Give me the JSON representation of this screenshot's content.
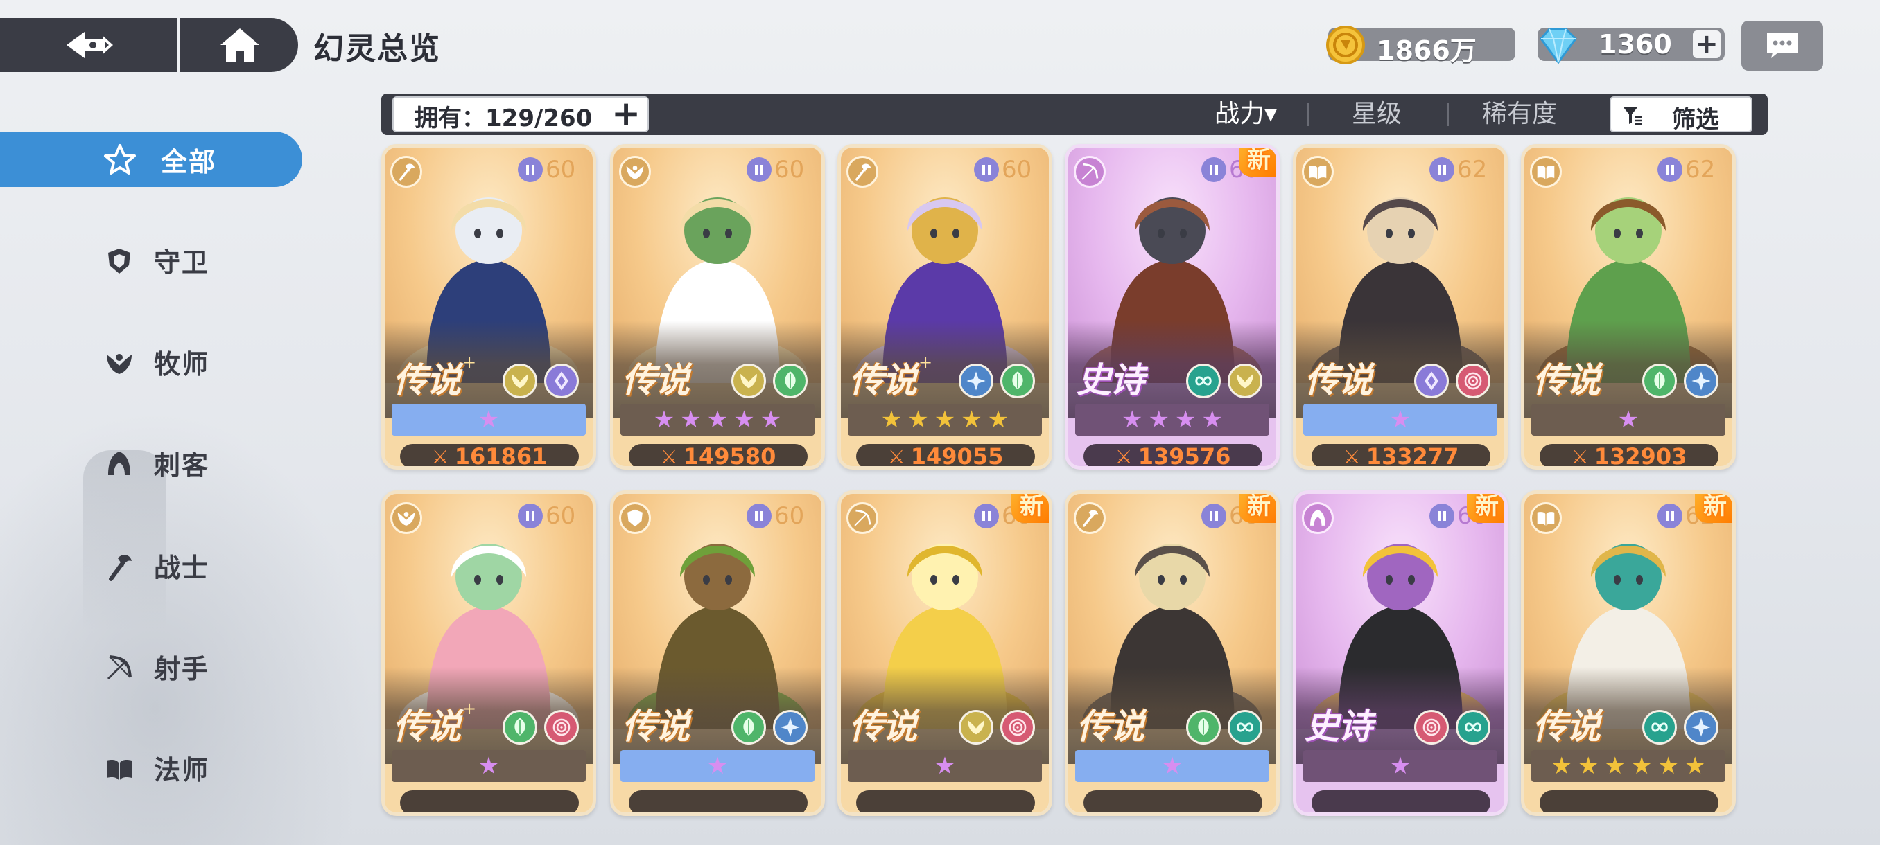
{
  "header": {
    "title": "幻灵总览",
    "gold": "1866万",
    "gems": "1360",
    "plus": "+"
  },
  "sidebar": {
    "items": [
      {
        "label": "全部",
        "icon": "all-star-icon",
        "active": true
      },
      {
        "label": "守卫",
        "icon": "shield-icon",
        "active": false
      },
      {
        "label": "牧师",
        "icon": "priest-wing-icon",
        "active": false
      },
      {
        "label": "刺客",
        "icon": "assassin-hood-icon",
        "active": false
      },
      {
        "label": "战士",
        "icon": "axe-icon",
        "active": false
      },
      {
        "label": "射手",
        "icon": "bow-icon",
        "active": false
      },
      {
        "label": "法师",
        "icon": "book-icon",
        "active": false
      }
    ]
  },
  "toolbar": {
    "owned": "拥有：129/260",
    "plus": "+",
    "sort_power": "战力▾",
    "sort_stars": "星级",
    "sort_rarity": "稀有度",
    "filter": "筛选"
  },
  "cards": [
    {
      "rarity": "传说",
      "plus": true,
      "level": "60",
      "class_icon": "axe-icon",
      "elements": [
        "wing-emblem-icon",
        "diamond-emblem-icon"
      ],
      "stars": 1,
      "star_color": "#d78ef0",
      "star_bar": "blue",
      "power": "161861",
      "new": false,
      "epic": false
    },
    {
      "rarity": "传说",
      "plus": false,
      "level": "60",
      "class_icon": "priest-wing-icon",
      "elements": [
        "wing-emblem-icon",
        "leaf-emblem-icon"
      ],
      "stars": 5,
      "star_color": "#d78ef0",
      "star_bar": "dark",
      "power": "149580",
      "new": false,
      "epic": false
    },
    {
      "rarity": "传说",
      "plus": true,
      "level": "60",
      "class_icon": "axe-icon",
      "elements": [
        "frost-emblem-icon",
        "leaf-emblem-icon"
      ],
      "stars": 5,
      "star_color": "#f2c23a",
      "star_bar": "dark",
      "power": "149055",
      "new": false,
      "epic": false
    },
    {
      "rarity": "史诗",
      "plus": false,
      "level": "60",
      "class_icon": "bow-icon",
      "elements": [
        "infinity-emblem-icon",
        "wing-emblem-icon"
      ],
      "stars": 4,
      "star_color": "#d78ef0",
      "star_bar": "dark",
      "power": "139576",
      "new": true,
      "epic": true
    },
    {
      "rarity": "传说",
      "plus": false,
      "level": "62",
      "class_icon": "book-icon",
      "elements": [
        "diamond-emblem-icon",
        "spiral-emblem-icon"
      ],
      "stars": 1,
      "star_color": "#d78ef0",
      "star_bar": "blue",
      "power": "133277",
      "new": false,
      "epic": false
    },
    {
      "rarity": "传说",
      "plus": false,
      "level": "62",
      "class_icon": "book-icon",
      "elements": [
        "leaf-emblem-icon",
        "frost-emblem-icon"
      ],
      "stars": 1,
      "star_color": "#d78ef0",
      "star_bar": "dark",
      "power": "132903",
      "new": false,
      "epic": false
    },
    {
      "rarity": "传说",
      "plus": true,
      "level": "60",
      "class_icon": "priest-wing-icon",
      "elements": [
        "leaf-emblem-icon",
        "spiral-emblem-icon"
      ],
      "stars": 1,
      "star_color": "#d78ef0",
      "star_bar": "dark",
      "power": "",
      "new": false,
      "epic": false
    },
    {
      "rarity": "传说",
      "plus": false,
      "level": "60",
      "class_icon": "shield-icon",
      "elements": [
        "leaf-emblem-icon",
        "frost-emblem-icon"
      ],
      "stars": 1,
      "star_color": "#d78ef0",
      "star_bar": "blue",
      "power": "",
      "new": false,
      "epic": false
    },
    {
      "rarity": "传说",
      "plus": false,
      "level": "60",
      "class_icon": "bow-icon",
      "elements": [
        "wing-emblem-icon",
        "spiral-emblem-icon"
      ],
      "stars": 1,
      "star_color": "#d78ef0",
      "star_bar": "dark",
      "power": "",
      "new": true,
      "epic": false
    },
    {
      "rarity": "传说",
      "plus": false,
      "level": "60",
      "class_icon": "axe-icon",
      "elements": [
        "leaf-emblem-icon",
        "infinity-emblem-icon"
      ],
      "stars": 1,
      "star_color": "#d78ef0",
      "star_bar": "blue",
      "power": "",
      "new": true,
      "epic": false
    },
    {
      "rarity": "史诗",
      "plus": false,
      "level": "60",
      "class_icon": "assassin-hood-icon",
      "elements": [
        "spiral-emblem-icon",
        "infinity-emblem-icon"
      ],
      "stars": 1,
      "star_color": "#d78ef0",
      "star_bar": "dark",
      "power": "",
      "new": true,
      "epic": true
    },
    {
      "rarity": "传说",
      "plus": false,
      "level": "62",
      "class_icon": "book-icon",
      "elements": [
        "infinity-emblem-icon",
        "frost-emblem-icon"
      ],
      "stars": 6,
      "star_color": "#f2c23a",
      "star_bar": "dark",
      "power": "",
      "new": true,
      "epic": false
    }
  ],
  "new_label": "新",
  "colors": {
    "accent": "#3c8fd6",
    "dark_bar": "#3a3c45",
    "power_text": "#ff8a3a"
  }
}
